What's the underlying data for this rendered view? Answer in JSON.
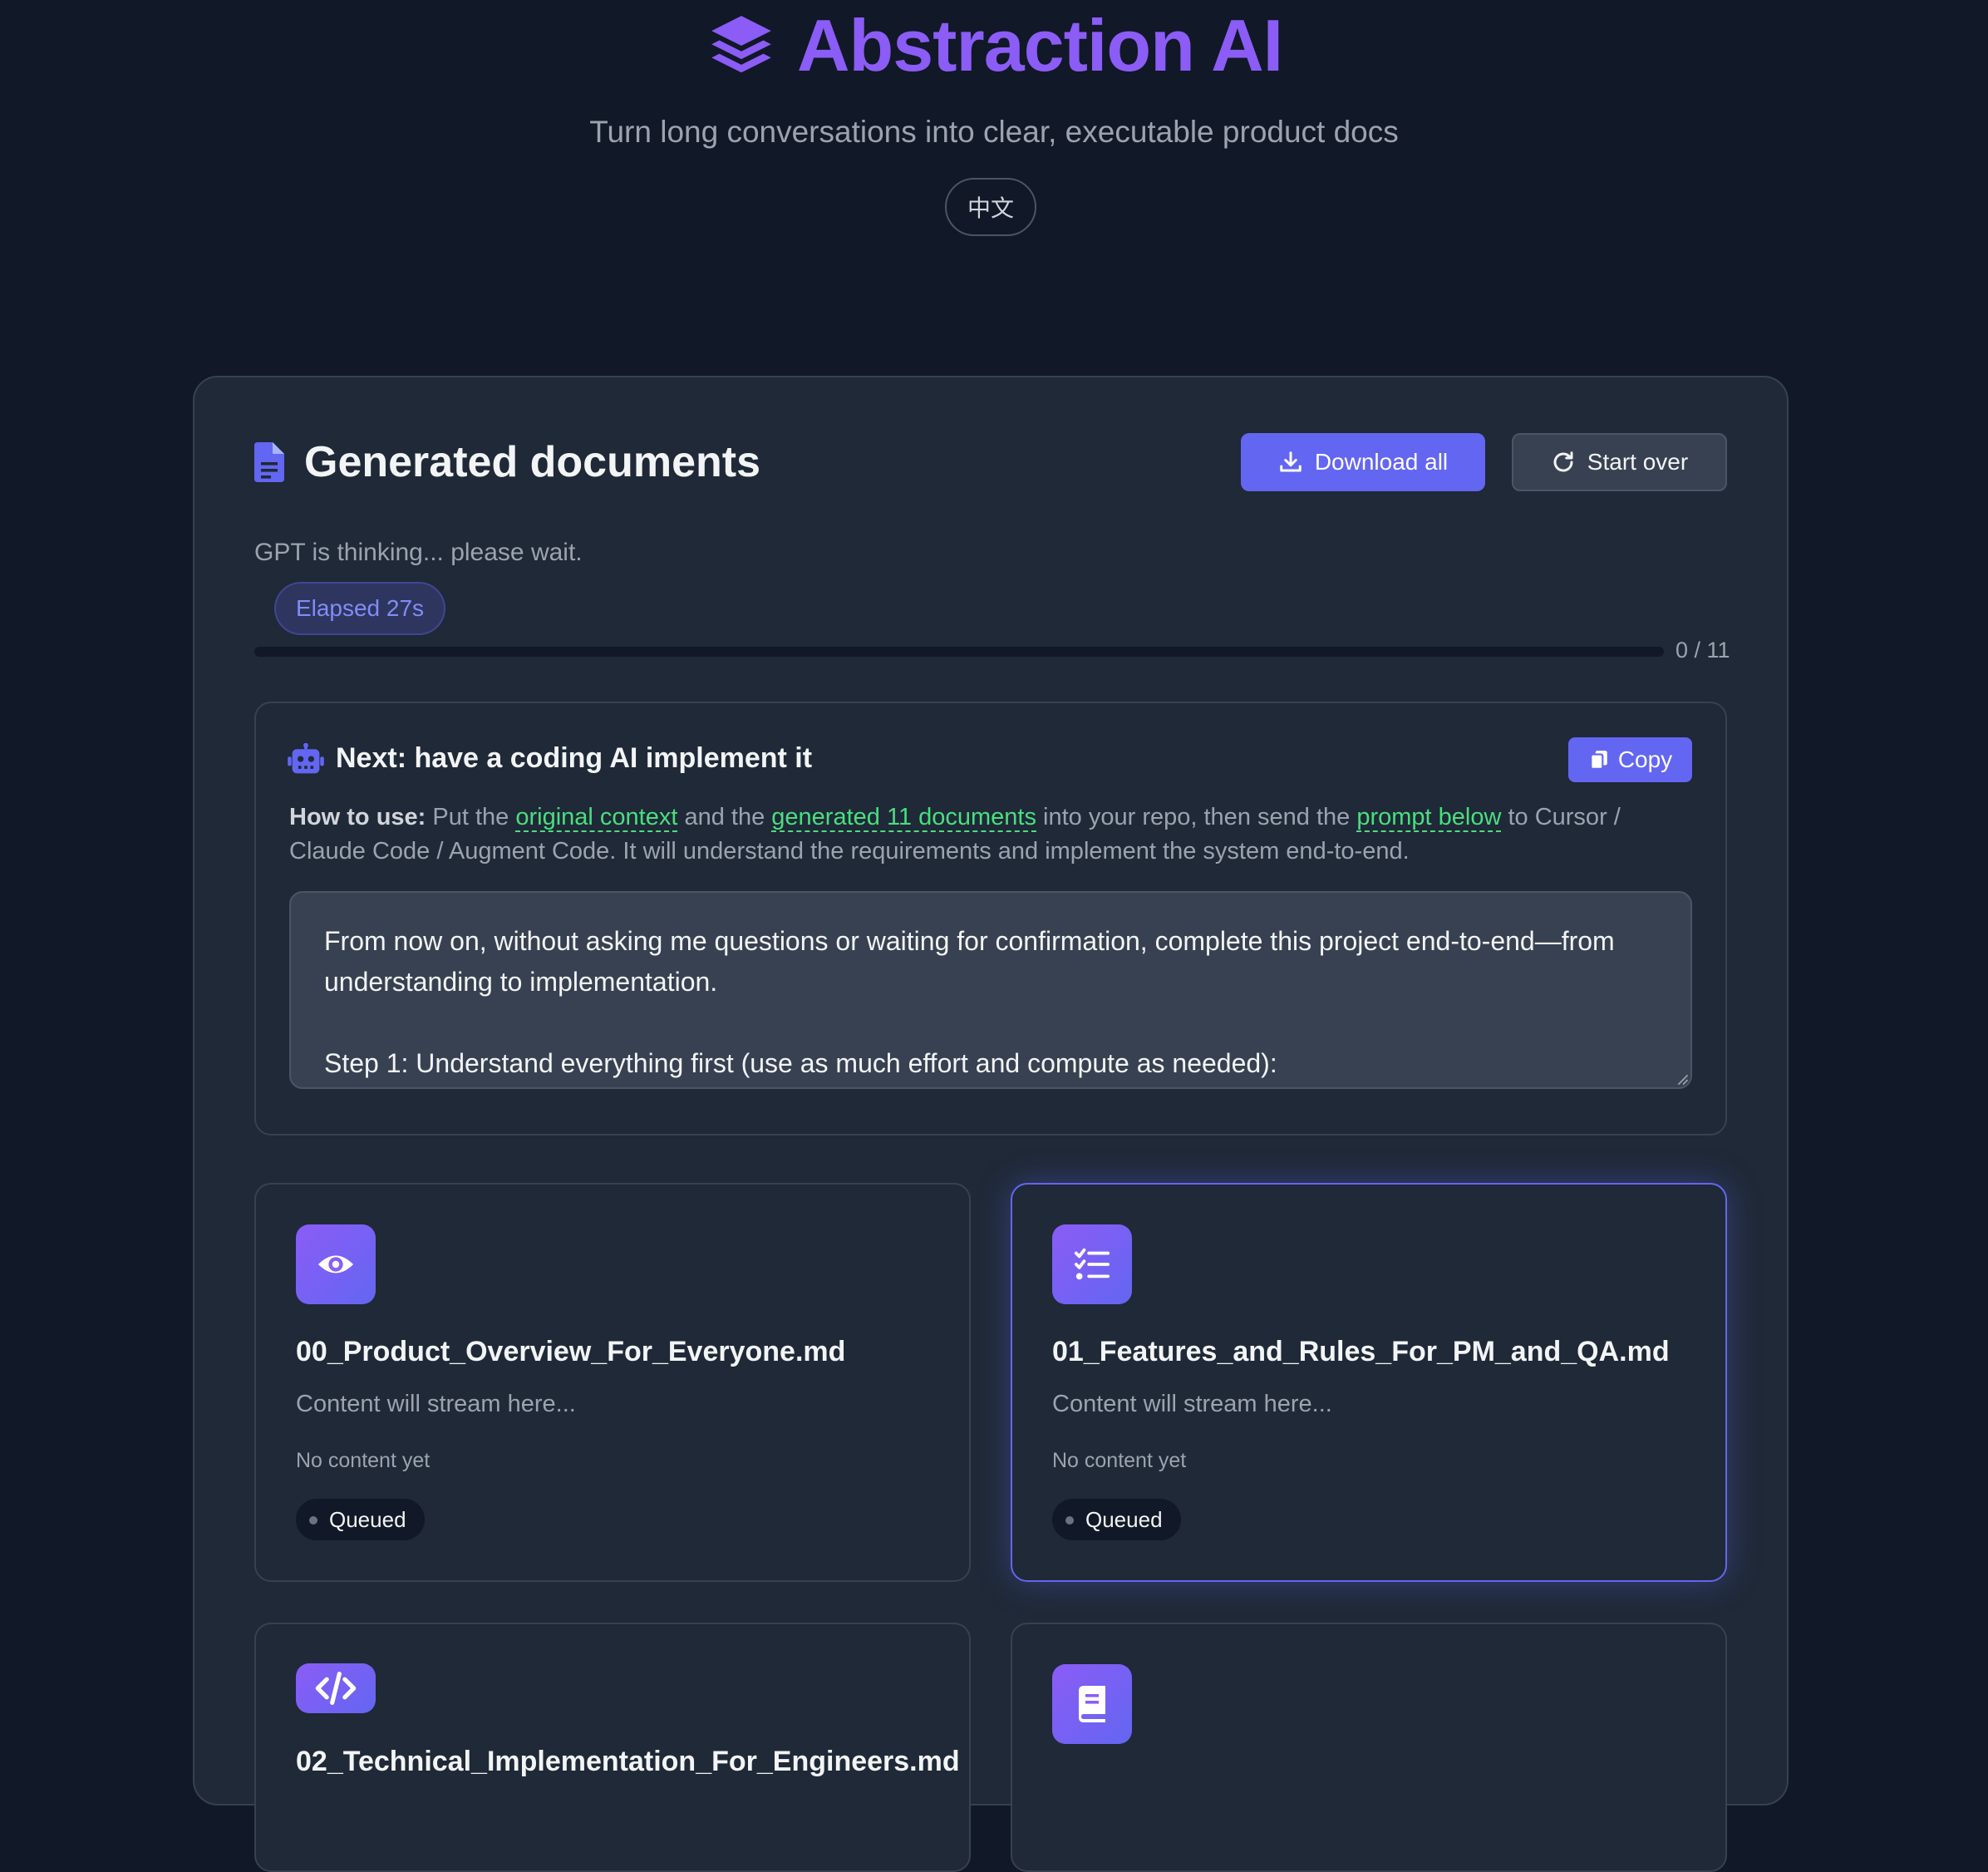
{
  "app": {
    "title": "Abstraction AI",
    "tagline": "Turn long conversations into clear, executable product docs",
    "language_toggle": "中文",
    "accent_color": "#8b5cf6",
    "primary_color": "#6366f1"
  },
  "documents": {
    "title": "Generated documents",
    "download_all_label": "Download all",
    "start_over_label": "Start over",
    "status": "GPT is thinking... please wait.",
    "elapsed": "Elapsed 27s",
    "progress_fraction": 0,
    "progress_label": "0 / 11"
  },
  "next_step": {
    "title": "Next: have a coding AI implement it",
    "copy_label": "Copy",
    "howto_label": "How to use:",
    "howto_part1": " Put the ",
    "howto_link1": "original context",
    "howto_part2": " and the ",
    "howto_link2": "generated 11 documents",
    "howto_part3": " into your repo, then send the ",
    "howto_link3": "prompt below",
    "howto_part4": " to Cursor / Claude Code / Augment Code. It will understand the requirements and implement the system end-to-end.",
    "prompt_text": "From now on, without asking me questions or waiting for confirmation, complete this project end-to-end—from understanding to implementation.\n\nStep 1: Understand everything first (use as much effort and compute as needed):"
  },
  "cards": [
    {
      "icon": "eye-icon",
      "name": "00_Product_Overview_For_Everyone.md",
      "stream": "Content will stream here...",
      "empty": "No content yet",
      "status": "Queued"
    },
    {
      "icon": "checklist-icon",
      "name": "01_Features_and_Rules_For_PM_and_QA.md",
      "stream": "Content will stream here...",
      "empty": "No content yet",
      "status": "Queued"
    },
    {
      "icon": "code-icon",
      "name": "02_Technical_Implementation_For_Engineers.md"
    },
    {
      "icon": "book-icon"
    }
  ]
}
